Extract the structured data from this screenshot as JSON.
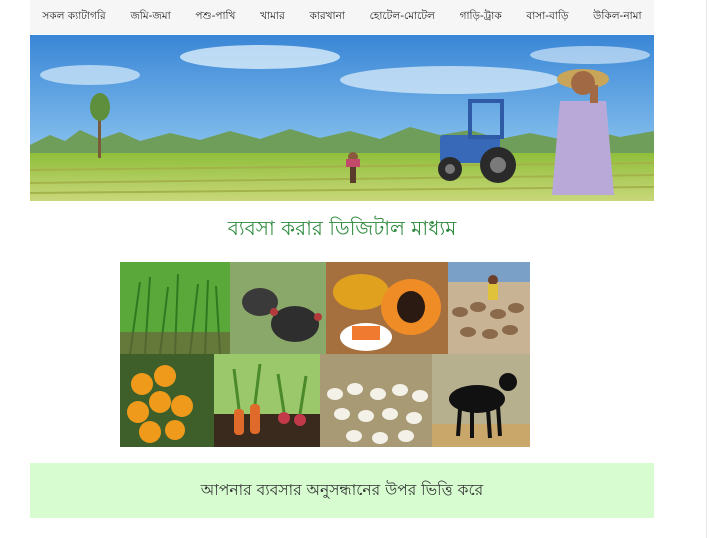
{
  "nav": {
    "items": [
      {
        "label": "সকল ক্যাটাগরি"
      },
      {
        "label": "জমি-জমা"
      },
      {
        "label": "পশু-পাখি"
      },
      {
        "label": "খামার"
      },
      {
        "label": "কারখানা"
      },
      {
        "label": "হোটেল-মোটেল"
      },
      {
        "label": "গাড়ি-ট্রাক"
      },
      {
        "label": "বাসা-বাড়ি"
      },
      {
        "label": "উকিল-নামা"
      }
    ]
  },
  "hero": {
    "image": "farm-landscape-illustration"
  },
  "tagline": "ব্যবসা করার ডিজিটাল মাধ্যম",
  "collage": {
    "tiles": [
      "rice-seedlings",
      "turkeys",
      "papaya",
      "ducks-farm",
      "oranges",
      "carrots",
      "chickens-poultry",
      "black-goat"
    ]
  },
  "banner": {
    "text": "আপনার ব্যবসার অনুসন্ধানের উপর ভিত্তি করে"
  }
}
